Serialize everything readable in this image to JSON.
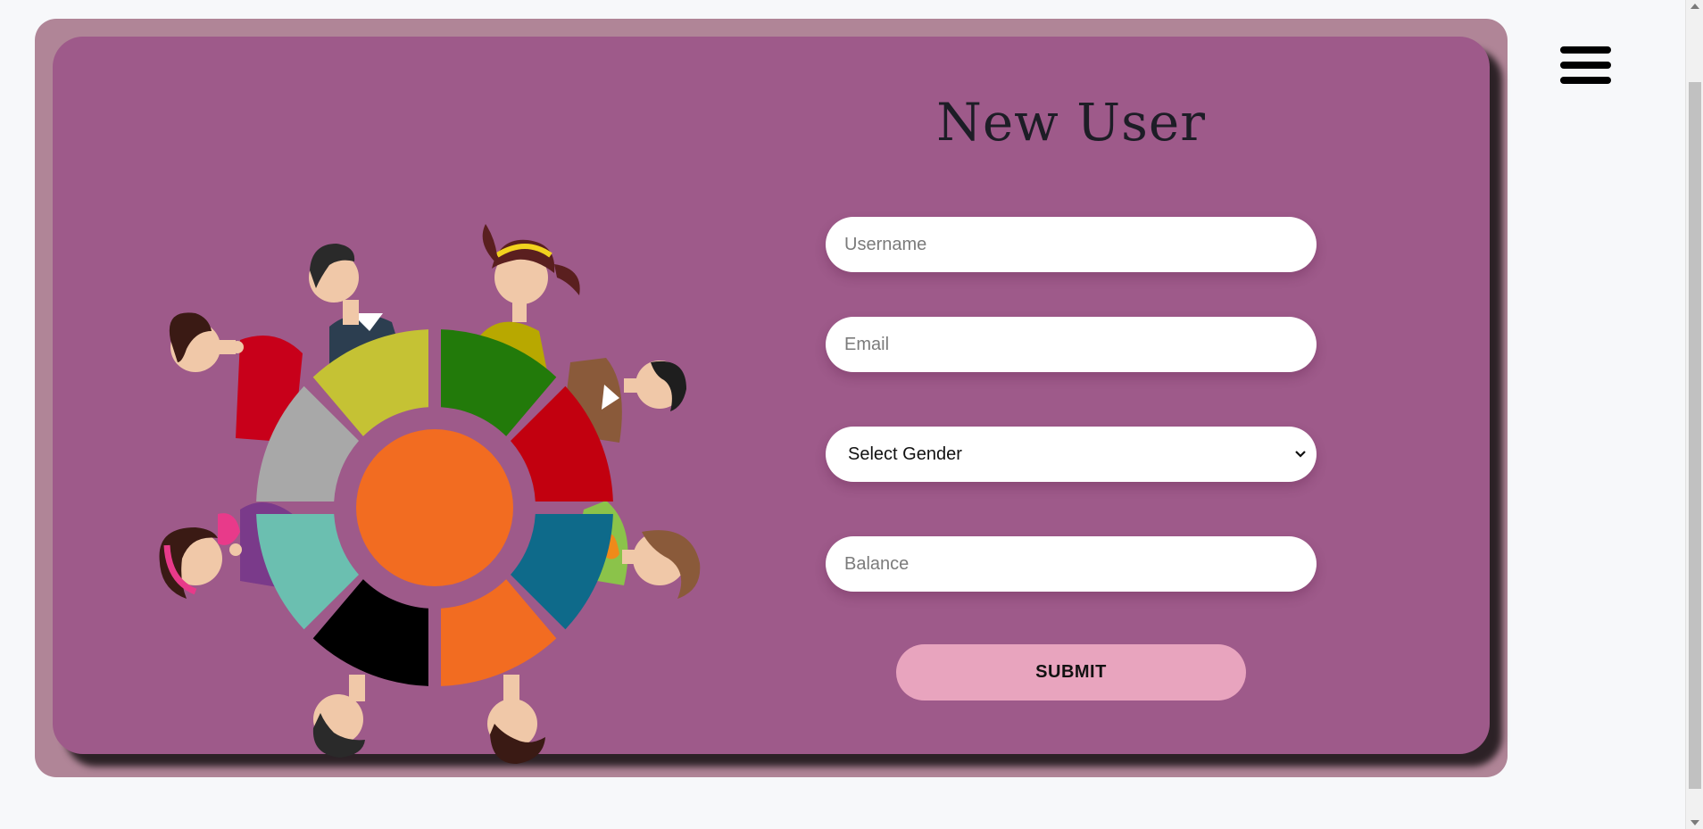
{
  "form": {
    "title": "New User",
    "username_placeholder": "Username",
    "email_placeholder": "Email",
    "gender_selected": "Select Gender",
    "balance_placeholder": "Balance",
    "submit_label": "SUBMIT"
  },
  "icons": {
    "menu": "hamburger-menu-icon",
    "select_arrow": "chevron-down-icon"
  },
  "colors": {
    "page_background": "#f7f8fa",
    "outer_card": "#b08597",
    "inner_card": "#9e5a8a",
    "submit_button": "#e8a4be",
    "input_background": "#ffffff",
    "title_text": "#1d1d26"
  }
}
